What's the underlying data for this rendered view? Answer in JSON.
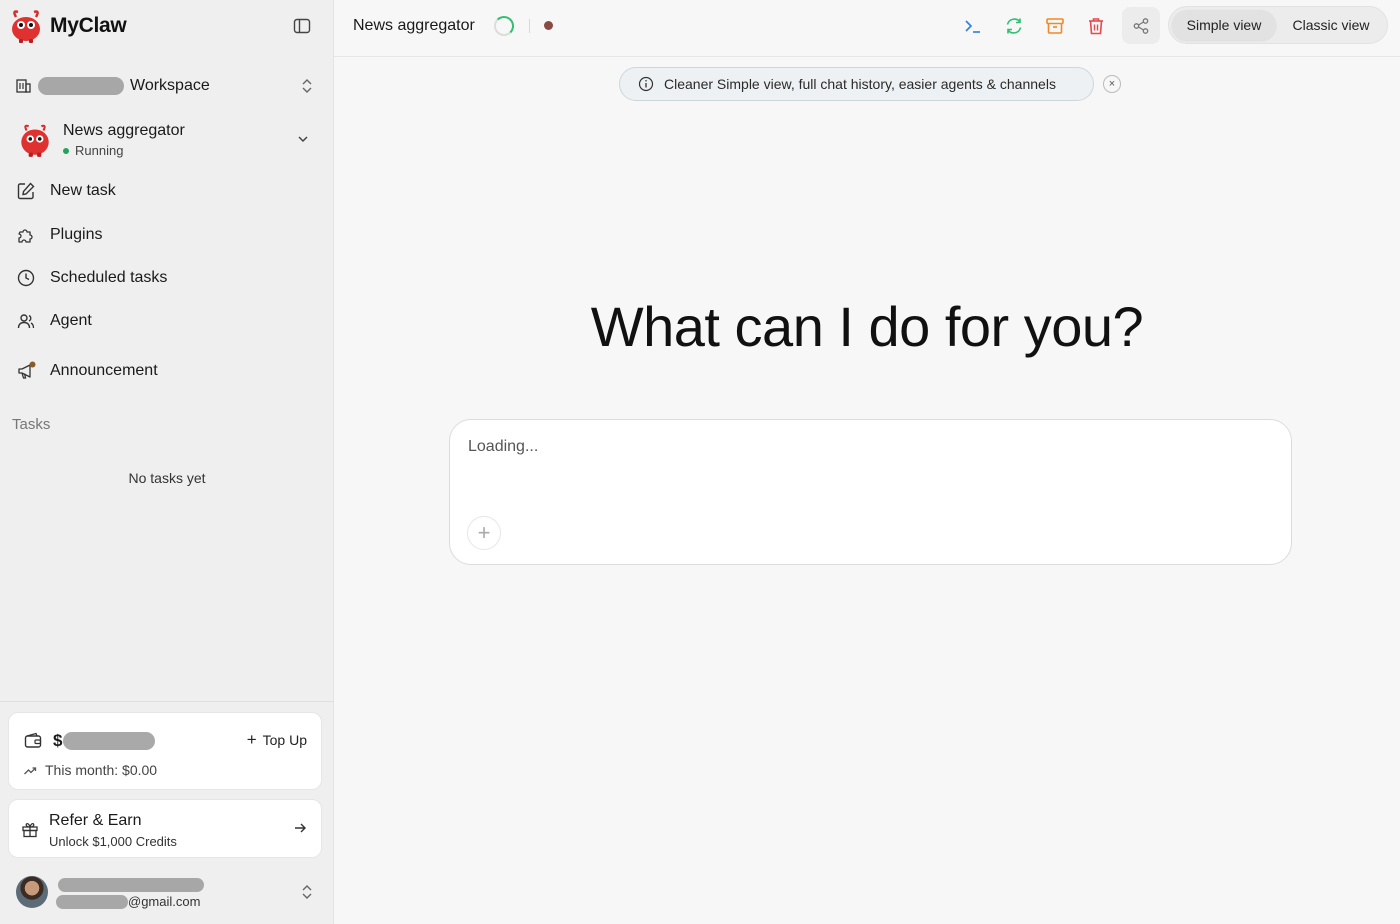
{
  "app": {
    "name": "MyClaw"
  },
  "workspace": {
    "label": "Workspace"
  },
  "agent": {
    "name": "News aggregator",
    "status": "Running"
  },
  "nav": {
    "new_task": "New task",
    "plugins": "Plugins",
    "scheduled_tasks": "Scheduled tasks",
    "agent": "Agent",
    "announcement": "Announcement"
  },
  "tasks": {
    "section_label": "Tasks",
    "empty_text": "No tasks yet"
  },
  "balance": {
    "currency_prefix": "$",
    "top_up_label": "Top Up",
    "this_month": "This month: $0.00"
  },
  "refer": {
    "title": "Refer & Earn",
    "subtitle": "Unlock $1,000 Credits"
  },
  "user": {
    "email_suffix": "@gmail.com"
  },
  "topbar": {
    "title": "News aggregator",
    "views": {
      "simple": "Simple view",
      "classic": "Classic view",
      "active": "simple"
    }
  },
  "banner": {
    "text": "Cleaner Simple view, full chat history, easier agents & channels",
    "close": "×"
  },
  "main": {
    "headline": "What can I do for you?"
  },
  "composer": {
    "placeholder": "Loading...",
    "attach": "+"
  },
  "colors": {
    "terminal_icon": "#2d7fe0",
    "refresh_icon": "#2fbf71",
    "archive_icon": "#f08a24",
    "delete_icon": "#e5484d",
    "status_running": "#22a45d",
    "record_dot": "#8a4a42"
  },
  "icons": [
    "terminal-icon",
    "refresh-icon",
    "archive-icon",
    "trash-icon",
    "share-icon"
  ]
}
